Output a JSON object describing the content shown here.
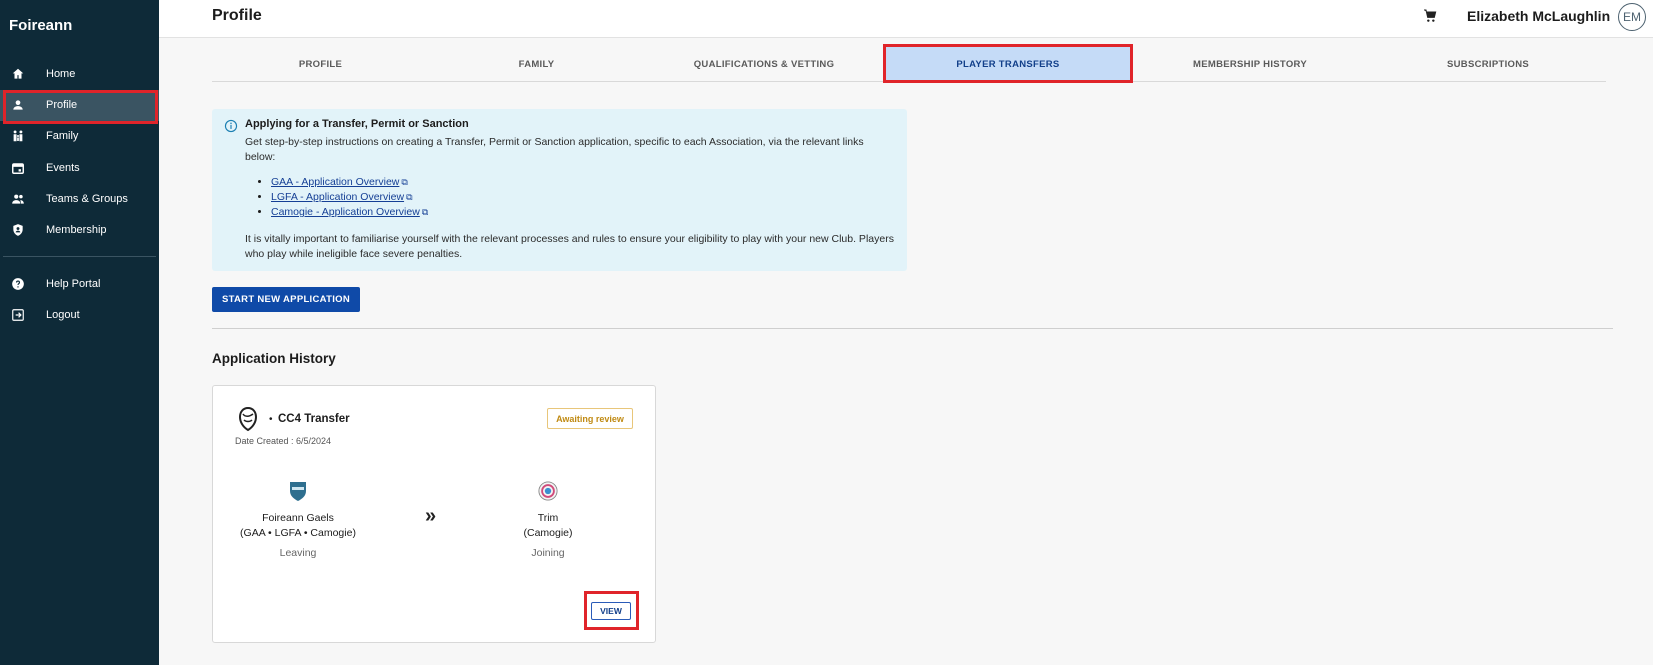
{
  "sidebar": {
    "brand": "Foireann",
    "items": [
      {
        "label": "Home",
        "icon": "home-icon"
      },
      {
        "label": "Profile",
        "icon": "person-icon"
      },
      {
        "label": "Family",
        "icon": "family-icon"
      },
      {
        "label": "Events",
        "icon": "calendar-icon"
      },
      {
        "label": "Teams & Groups",
        "icon": "group-icon"
      },
      {
        "label": "Membership",
        "icon": "shield-icon"
      }
    ],
    "bottom_items": [
      {
        "label": "Help Portal",
        "icon": "help-icon"
      },
      {
        "label": "Logout",
        "icon": "logout-icon"
      }
    ],
    "active": "Profile"
  },
  "header": {
    "title": "Profile",
    "user_name": "Elizabeth McLaughlin",
    "avatar_initials": "EM"
  },
  "tabs": {
    "items": [
      "PROFILE",
      "FAMILY",
      "QUALIFICATIONS & VETTING",
      "PLAYER TRANSFERS",
      "MEMBERSHIP HISTORY",
      "SUBSCRIPTIONS"
    ],
    "active": "PLAYER TRANSFERS"
  },
  "info": {
    "title": "Applying for a Transfer, Permit or Sanction",
    "body": "Get step-by-step instructions on creating a Transfer, Permit or Sanction application, specific to each Association, via the relevant links below:",
    "links": [
      "GAA - Application Overview",
      "LGFA - Application Overview",
      "Camogie - Application Overview"
    ],
    "footer": "It is vitally important to familiarise yourself with the relevant processes and rules to ensure your eligibility to play with your new Club. Players who play while ineligible face severe penalties."
  },
  "start_button": "START NEW APPLICATION",
  "history": {
    "title": "Application History",
    "card": {
      "title": "CC4 Transfer",
      "date": "Date Created : 6/5/2024",
      "status": "Awaiting review",
      "from": {
        "name": "Foireann Gaels",
        "assoc": "(GAA • LGFA • Camogie)",
        "role": "Leaving"
      },
      "to": {
        "name": "Trim",
        "assoc": "(Camogie)",
        "role": "Joining"
      },
      "view_button": "VIEW"
    }
  },
  "colors": {
    "sidebar_bg": "#0e2a38",
    "primary": "#0f4aa8",
    "active_tab_bg": "#c5dbf7",
    "highlight": "#e0242a",
    "info_bg": "#e2f3f9",
    "status": "#c08a13"
  }
}
